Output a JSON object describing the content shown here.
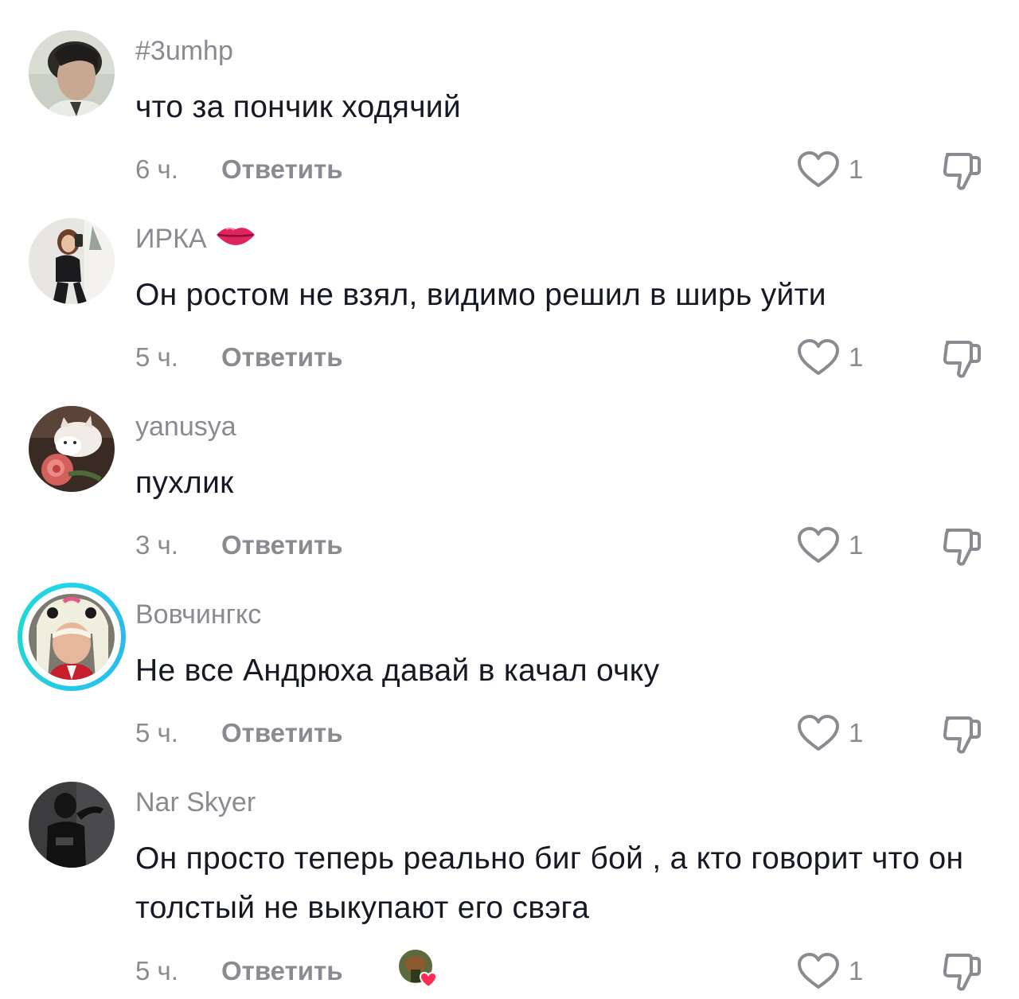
{
  "comments": [
    {
      "username": "#3umhp",
      "text": "что за пончик ходячий",
      "time": "6 ч.",
      "reply_label": "Ответить",
      "likes": "1"
    },
    {
      "username": "ИРКА",
      "text": "Он ростом не взял, видимо решил в ширь уйти",
      "time": "5 ч.",
      "reply_label": "Ответить",
      "likes": "1"
    },
    {
      "username": "yanusya",
      "text": "пухлик",
      "time": "3 ч.",
      "reply_label": "Ответить",
      "likes": "1"
    },
    {
      "username": "Вовчингкс",
      "text": "Не все Андрюха давай в качал очку",
      "time": "5 ч.",
      "reply_label": "Ответить",
      "likes": "1"
    },
    {
      "username": "Nar Skyer",
      "text": "Он просто теперь реально биг бой , а кто говорит что он толстый не выкупают его свэга",
      "time": "5 ч.",
      "reply_label": "Ответить",
      "likes": "1"
    }
  ],
  "icons": {
    "like": "heart-outline-icon",
    "dislike": "thumbs-down-icon",
    "username_emoji": "lips-emoji-icon",
    "creator_liked": "creator-liked-icon"
  },
  "colors": {
    "text": "#161823",
    "secondary": "#8a8b91",
    "story_ring": "#20d5ec",
    "creator_heart": "#fe2c55"
  }
}
